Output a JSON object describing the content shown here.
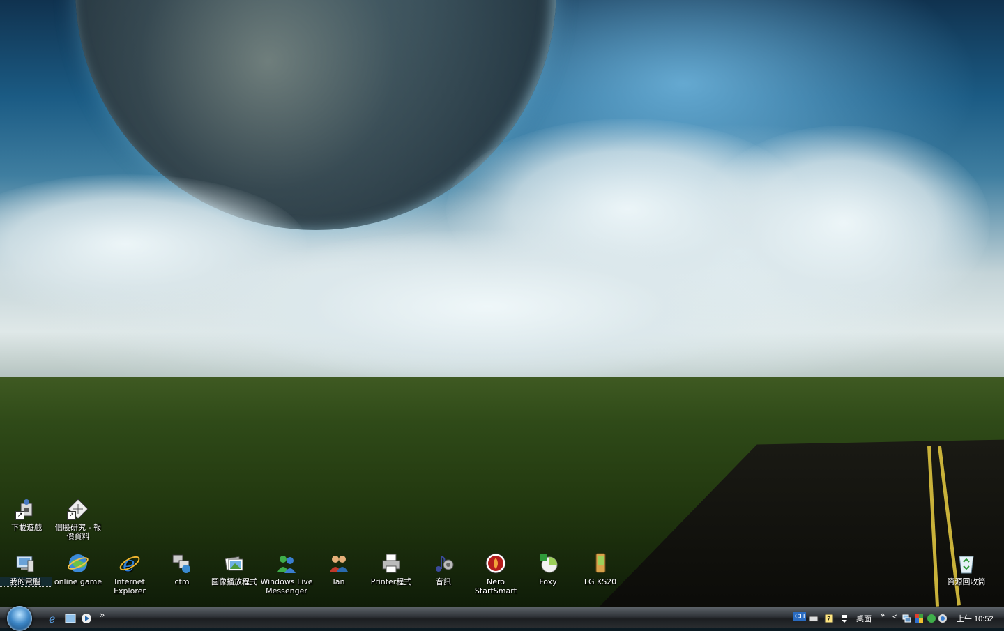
{
  "desktop": {
    "top_icons": [
      {
        "label": "下載遊戲",
        "icon": "game-download-shortcut-icon"
      },
      {
        "label": "個股研究 - 報價資料",
        "icon": "stock-research-shortcut-icon"
      }
    ],
    "icons": [
      {
        "label": "我的電腦",
        "icon": "my-computer-icon"
      },
      {
        "label": "online game",
        "icon": "online-game-globe-icon"
      },
      {
        "label": "Internet Explorer",
        "icon": "internet-explorer-icon"
      },
      {
        "label": "ctm",
        "icon": "network-computers-icon"
      },
      {
        "label": "圖像播放程式",
        "icon": "image-viewer-icon"
      },
      {
        "label": "Windows Live Messenger",
        "icon": "messenger-icon"
      },
      {
        "label": "Ian",
        "icon": "user-folder-icon"
      },
      {
        "label": "Printer程式",
        "icon": "printer-icon"
      },
      {
        "label": "音訊",
        "icon": "audio-icon"
      },
      {
        "label": "Nero StartSmart",
        "icon": "nero-icon"
      },
      {
        "label": "Foxy",
        "icon": "foxy-icon"
      },
      {
        "label": "LG KS20",
        "icon": "phone-icon"
      }
    ],
    "recycle_bin": {
      "label": "資源回收筒",
      "icon": "recycle-bin-icon"
    }
  },
  "taskbar": {
    "quick_launch_chevron": "»",
    "language": "CH",
    "desktop_toolbar_label": "桌面",
    "toolbar_chevron": "»",
    "tray_expand": "<",
    "clock": "上午 10:52"
  }
}
